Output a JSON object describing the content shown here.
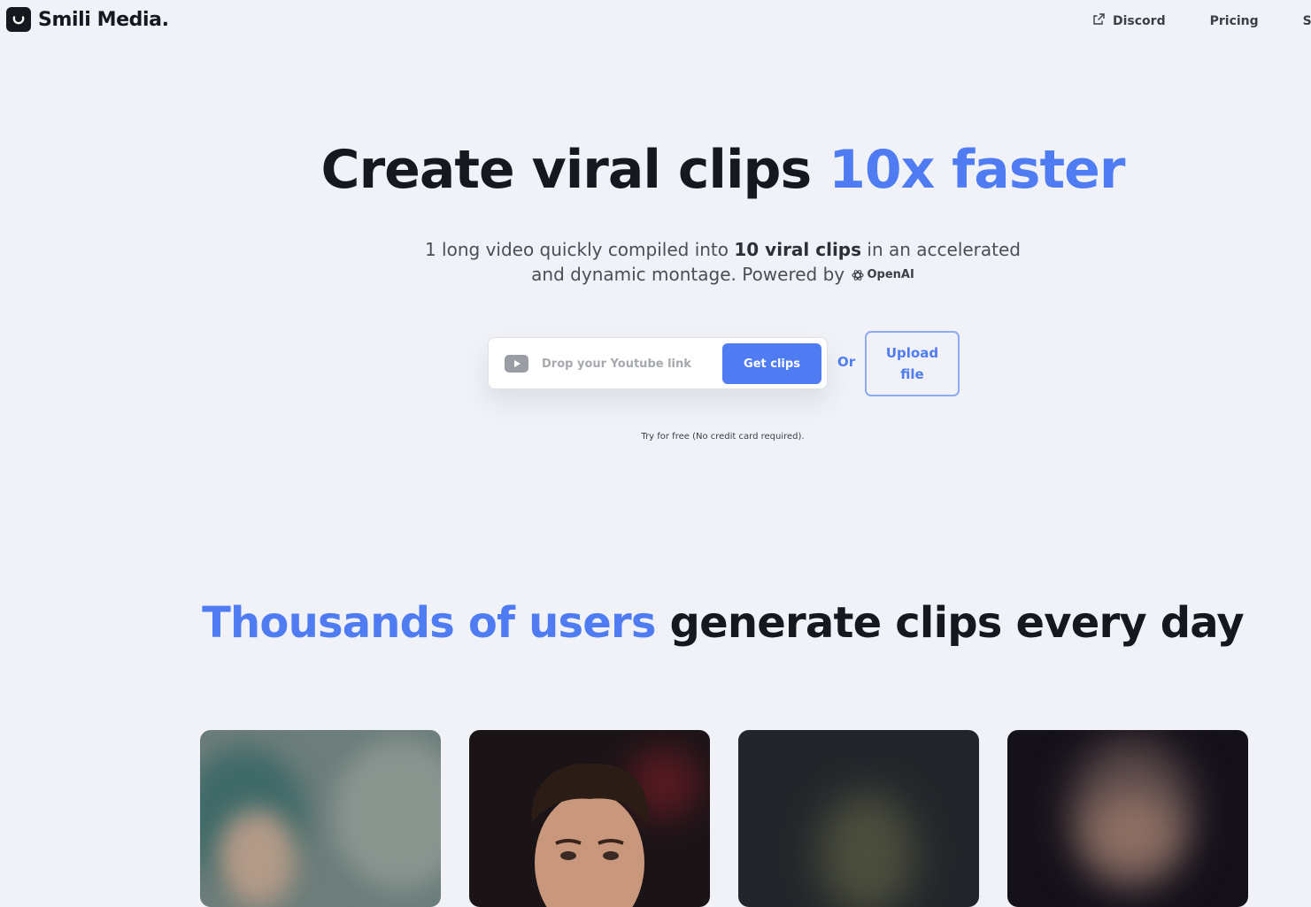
{
  "header": {
    "brand_name": "Smili Media.",
    "nav": {
      "discord_label": "Discord",
      "pricing_label": "Pricing",
      "signin_label": "Sig"
    }
  },
  "hero": {
    "title_main": "Create viral clips",
    "title_accent": "10x faster",
    "subtitle_line1_a": "1 long video quickly compiled into",
    "subtitle_line1_strong": "10 viral clips",
    "subtitle_line1_b": "in an accelerated",
    "subtitle_line2": "and dynamic montage. Powered by",
    "powered_by_logo_text": "OpenAI",
    "input": {
      "placeholder": "Drop your Youtube link",
      "value": ""
    },
    "get_clips_label": "Get clips",
    "or_label": "Or",
    "upload_label": "Upload file",
    "note": "Try for free (No credit card required)."
  },
  "social_proof": {
    "title_accent": "Thousands of users",
    "title_main": "generate clips every day",
    "cards": [
      {
        "alt": "clip preview 1"
      },
      {
        "alt": "clip preview 2"
      },
      {
        "alt": "clip preview 3"
      },
      {
        "alt": "clip preview 4"
      }
    ]
  },
  "colors": {
    "accent": "#4f7cf2",
    "background": "#f0f2f7",
    "text": "#15181e"
  }
}
